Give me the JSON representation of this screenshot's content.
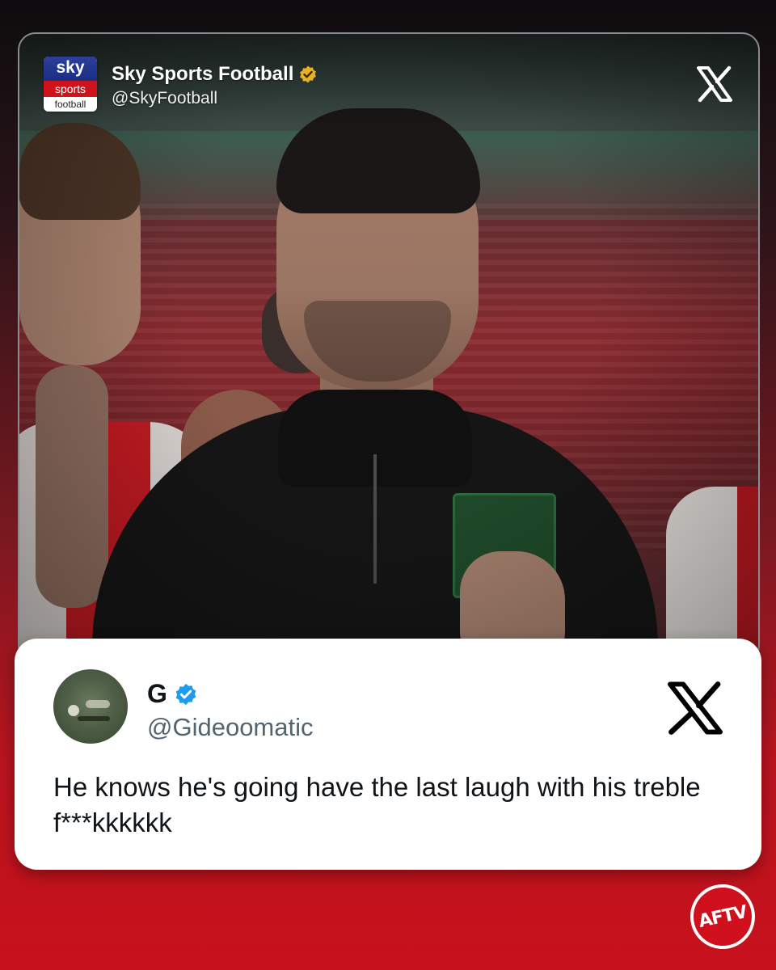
{
  "original_post": {
    "account_name": "Sky Sports Football",
    "handle": "@SkyFootball",
    "logo": {
      "line1": "sky",
      "line2": "sports",
      "line3": "football"
    },
    "verified_badge": "gold-verified-icon",
    "platform_icon": "x-logo-icon"
  },
  "reply": {
    "account_name": "G",
    "handle": "@Gideoomatic",
    "verified_badge": "blue-verified-icon",
    "platform_icon": "x-logo-icon",
    "text": "He knows he's going have the last laugh with his treble f***kkkkkk"
  },
  "watermark": {
    "label": "AFTV"
  },
  "colors": {
    "brand_red": "#c8111c",
    "sky_blue": "#1b2e82",
    "verified_gold": "#e8b024",
    "verified_blue": "#1d9bf0"
  }
}
